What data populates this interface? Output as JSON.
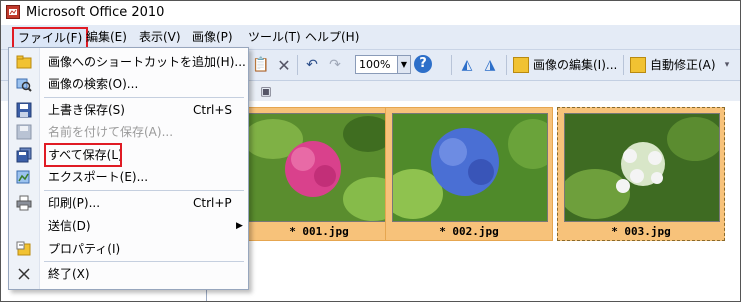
{
  "window": {
    "title": "Microsoft Office 2010"
  },
  "menubar": {
    "items": [
      {
        "label": "ファイル(F)"
      },
      {
        "label": "編集(E)"
      },
      {
        "label": "表示(V)"
      },
      {
        "label": "画像(P)"
      },
      {
        "label": "ツール(T)"
      },
      {
        "label": "ヘルプ(H)"
      }
    ]
  },
  "toolbar": {
    "zoom": "100%",
    "edit_picture": "画像の編集(I)...",
    "auto_correct": "自動修正(A)"
  },
  "file_menu": {
    "items": [
      {
        "label": "画像へのショートカットを追加(H)...",
        "shortcut": "",
        "icon": "add-shortcut-icon",
        "enabled": true
      },
      {
        "label": "画像の検索(O)...",
        "shortcut": "",
        "icon": "search-pictures-icon",
        "enabled": true
      },
      {
        "label": "上書き保存(S)",
        "shortcut": "Ctrl+S",
        "icon": "save-icon",
        "enabled": true
      },
      {
        "label": "名前を付けて保存(A)...",
        "shortcut": "",
        "icon": "save-as-icon",
        "enabled": false
      },
      {
        "label": "すべて保存(L)",
        "shortcut": "",
        "icon": "save-all-icon",
        "enabled": true
      },
      {
        "label": "エクスポート(E)...",
        "shortcut": "",
        "icon": "export-icon",
        "enabled": true
      },
      {
        "label": "印刷(P)...",
        "shortcut": "Ctrl+P",
        "icon": "print-icon",
        "enabled": true
      },
      {
        "label": "送信(D)",
        "shortcut": "",
        "icon": "",
        "enabled": true,
        "submenu": "▶"
      },
      {
        "label": "プロパティ(I)",
        "shortcut": "",
        "icon": "properties-icon",
        "enabled": true
      },
      {
        "label": "終了(X)",
        "shortcut": "",
        "icon": "close-icon",
        "enabled": true
      }
    ]
  },
  "thumbnails": [
    {
      "label": "* 001.jpg",
      "flower_color": "#d9418c"
    },
    {
      "label": "* 002.jpg",
      "flower_color": "#4a6fd4"
    },
    {
      "label": "* 003.jpg",
      "flower_color": "#f4f4f4"
    }
  ],
  "colors": {
    "highlight": "#e01b24",
    "thumb_bg": "#f7c27a",
    "menu_bg": "#e4ebf6"
  }
}
